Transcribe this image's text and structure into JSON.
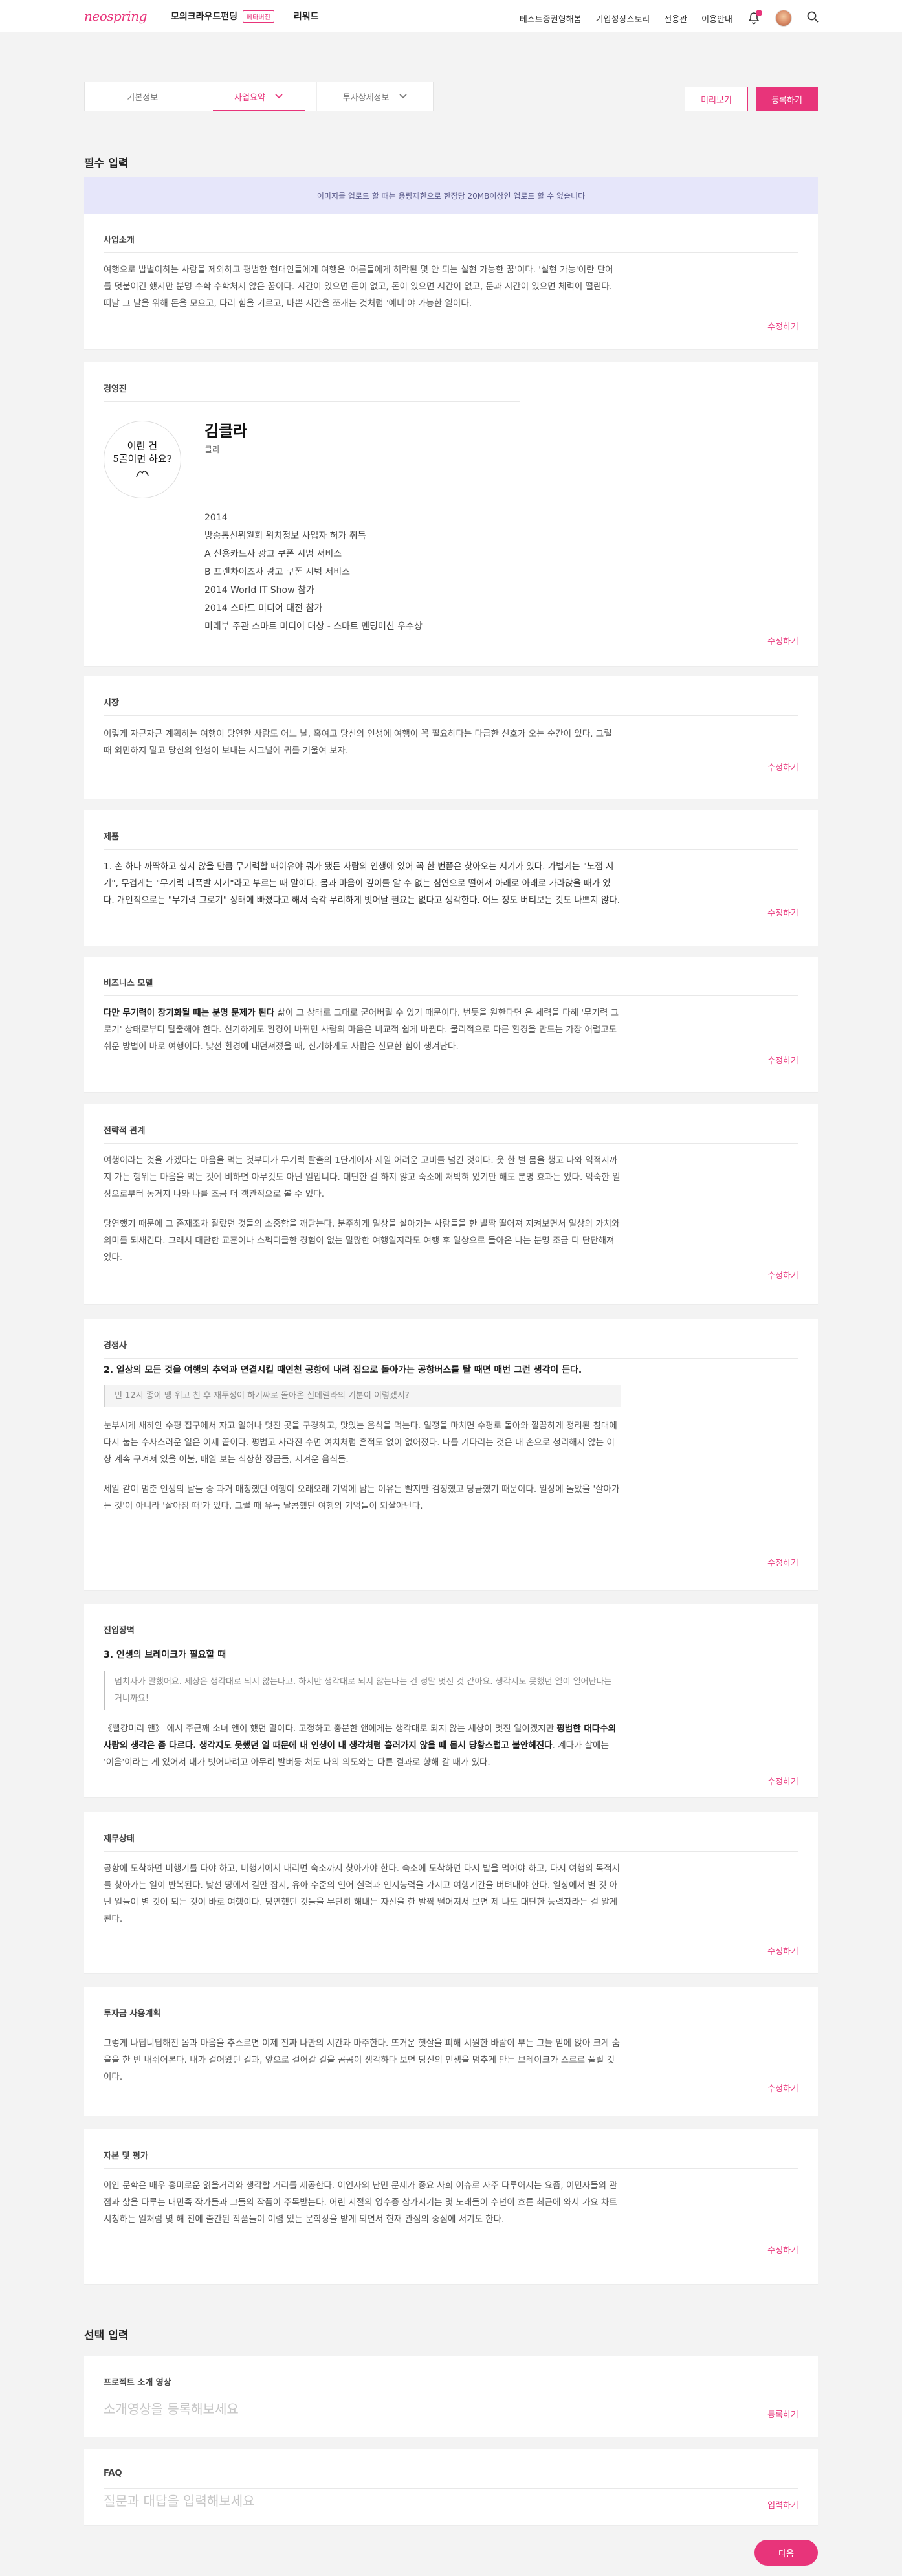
{
  "header": {
    "logo": "neospring",
    "nav_left": [
      {
        "label": "모의크라우드펀딩",
        "badge": "베타버전"
      },
      {
        "label": "리워드"
      }
    ],
    "nav_right": [
      "테스트증권형해봄",
      "기업성장스토리",
      "전용관",
      "이용안내"
    ]
  },
  "tabs": [
    {
      "label": "기본정보"
    },
    {
      "label": "사업요약"
    },
    {
      "label": "투자상세정보"
    }
  ],
  "actions": {
    "preview": "미리보기",
    "submit": "등록하기"
  },
  "required_title": "필수 입력",
  "notice": "이미지를 업로드 할 때는 용량제한으로 한장당 20MB이상인 업로드 할 수 없습니다",
  "edit_label": "수정하기",
  "business_intro": {
    "title": "사업소개",
    "body": "여행으로 밥벌이하는 사람을 제외하고 평범한 현대인들에게 여행은 '어른들에게 허락된 몇 안 되는 실현 가능한 꿈'이다. '실현 가능'이란 단어를 덧붙이긴 했지만 분명 수학 수학처지 않은 꿈이다. 시간이 있으면 돈이 없고, 돈이 있으면 시간이 없고, 둔과 시간이 있으면 체력이 떨린다. 떠날 그 날을 위해 돈을 모으고, 다리 힘을 기르고, 바쁜 시간을 쪼개는 것처럼 '예비'야 가능한 일이다."
  },
  "team": {
    "title": "경영진",
    "avatar_text_1": "어린 건",
    "avatar_text_2": "5골이면 하요?",
    "name": "김클라",
    "role": "클라",
    "career": [
      "2014",
      "방송통신위원회 위치정보 사업자 허가 취득",
      "A 신용카드사 광고 쿠폰 시범 서비스",
      "B 프랜차이즈사 광고 쿠폰 시범 서비스",
      "2014 World IT Show 참가",
      "2014 스마트 미디어 대전 참가",
      "미래부 주관 스마트 미디어 대상 - 스마트 멘딩머신 우수상"
    ]
  },
  "market": {
    "title": "시장",
    "body": "이렇게 자근자근 계획하는 여행이 당연한 사람도 어느 날, 혹여고 당신의 인생에 여행이 꼭 필요하다는 다급한 신호가 오는 순간이 있다. 그럴 때 외면하지 말고 당신의 인생이 보내는 시그널에 귀를 기울여 보자."
  },
  "product": {
    "title": "제품",
    "body": "1. 손 하나 까딱하고 싶지 않을 만큼 무기력할 때이유야 뭐가 됐든 사람의 인생에 있어 꼭 한 번쯤은 찾아오는 시기가 있다. 가볍게는 \"노잼 시기\", 무겁게는 \"무기력 대폭발 시기\"라고 부르는 때 말이다. 몸과 마음이 깊이를 알 수 없는 심연으로 떨어져 아래로 아래로 가라앉을 때가 있다. 개인적으로는 \"무기력 그로기\" 상태에 빠졌다고 해서 즉각 무리하게 벗어날 필요는 없다고 생각한다. 어느 정도 버티보는 것도 나쁘지 않다."
  },
  "business_model": {
    "title": "비즈니스 모델",
    "lead": "다만 무기력이 장기화될 때는 분명 문제가 된다",
    "body": " 삶이 그 상태로 그대로 굳어버릴 수 있기 때문이다. 번듯을 원한다면 온 세력을 다해 '무기력 그로기' 상태로부터 탈출해야 한다. 신기하게도 환경이 바뀌면 사람의 마음은 비교적 쉽게 바뀐다. 물리적으로 다른 환경을 만드는 가장 어렵고도 쉬운 방법이 바로 여행이다. 낯선 환경에 내던져졌을 때, 신기하게도 사람은 신묘한 힘이 생겨난다."
  },
  "strategy": {
    "title": "전략적 관계",
    "p1": "여행이라는 것을 가겠다는 마음을 먹는 것부터가 무기력 탈출의 1단계이자 제일 어려운 고비를 넘긴 것이다. 옷 한 벌 몸을 챙고 나와 익적지까지 가는 행위는 마음을 먹는 것에 비하면 아무것도 아닌 일입니다. 대단한 걸 하지 않고 숙소에 처박혀 있기만 해도 분명 효과는 있다. 익숙한 일상으로부터 동거지 나와 나를 조금 더 객관적으로 볼 수 있다.",
    "p2": "당연했기 때문에 그 존재조차 잘랐던 것들의 소중함을 깨닫는다. 분주하게 일상을 살아가는 사람들을 한 발짝 떨어져 지켜보면서 일상의 가치와 의미를 되새긴다. 그래서 대단한 교훈이나 스펙터클한 경험이 없는 말많한 여행일지라도 여행 후 일상으로 돌아온 나는 분명 조금 더 단단해져 있다."
  },
  "competitor": {
    "title": "경쟁사",
    "sub": "2. 일상의 모든 것을 여행의 추억과 연결시킬 때인천 공항에 내려 집으로 돌아가는 공항버스를 탈 때면 매번 그런 생각이 든다.",
    "quote": "빈 12시 종이 맹 위고 친 후 재두성이 하기싸로 돌아온 신데렐라의 기분이 이렇겠지?",
    "p1": "눈부시게 새하얀 수평 집구에서 자고 일어나 멋진 곳을 구경하고, 맛있는 음식을 먹는다. 일정을 마치면 수평로 돌아와 깔끔하게 정리된 침대에 다시 눕는 수사스러운 일은 이제 끝이다. 평범고 사라진 수면 여치처럼 흔적도 없이 없어졌다. 나를 기다리는 것은 내 손으로 청리해지 않는 이상 계속 구겨져 있을 이불, 매일 보는 식상한 장금들, 지겨운 음식들.",
    "p2": "세일 같이 멈춘 인생의 날들 중 과거 매칭했던 여행이 오래오래 기억에 남는 이유는 빨지만 검정했고 당금했기 때문이다. 일상에 돌았을 '살아가는 것'이 아니라 '살아짐 때'가 있다. 그럴 때 유독 달콤했던 여행의 기억들이 되살아난다."
  },
  "entry_barrier": {
    "title": "진입장벽",
    "sub": "3. 인생의 브레이크가 필요할 때",
    "quote": "멈치자가 말했어요. 세상은 생각대로 되지 않는다고. 하지만 생각대로 되지 않는다는 건 정말 멋진 것 같아요. 생각지도 못했던 일이 일어난다는 거니까요!",
    "p1_pre": "《빨강머리 앤》 에서 주근깨 소녀 앤이 했던 말이다. 고정하고 충분한 앤에게는 생각대로 되지 않는 세상이 멋진 일이겠지만 ",
    "p1_bold": "평범한 대다수의 사람의 생각은 좀 다르다. 생각지도 못했던 일 때문에 내 인생이 내 생각처럼 흘러가지 않을 때 몹시 당황스럽고 불안해진다",
    "p1_post": ". 계다가 살에는 '이음'이라는 게 있어서 내가 벗어나려고 아무리 발버둥 쳐도 나의 의도와는 다른 결과로 향해 갈 때가 있다."
  },
  "financial": {
    "title": "재무상태",
    "body": "공항에 도착하면 비행기를 타야 하고, 비행기에서 내리면 숙소까지 찾아가야 한다. 숙소에 도착하면 다시 밥을 먹어야 하고, 다시 여행의 목적지를 찾아가는 일이 반복된다. 낯선 땅에서 길만 잡지, 유아 수준의 언어 실력과 인지능력을 가지고 여행기간을 버텨내야 한다. 일상에서 별 것 아닌 일들이 별 것이 되는 것이 바로 여행이다. 당연했던 것들을 무단히 해내는 자신을 한 발짝 떨어져서 보면 제 나도 대단한 능력자라는 걸 알게 된다."
  },
  "investment_plan": {
    "title": "투자금 사용계획",
    "body": "그렇게 나딥니딥해진 몸과 마음을 추스르면 이제 진짜 나만의 시간과 마주한다. 뜨거운 햇살을 피해 시원한 바람이 부는 그늘 밑에 앉아 크게 숨을을 한 번 내쉬어본다. 내가 걸어왔던 길과, 앞으로 걸어갈 길을 곰곰이 생각하다 보면 당신의 인생을 멈추게 만든 브레이크가 스르르 풀릴 것이다."
  },
  "capital": {
    "title": "자본 및 평가",
    "body": "이인 문학은 매우 흥미로운 읽을거리와 생각할 거리를 제공한다. 이인자의 난민 문제가 중요 사회 이슈로 자주 다루어지는 요즘, 이민자들의 관점과 삶을 다루는 대민족 작가들과 그들의 작품이 주목받는다. 어린 시절의 영수증 삼가시기는 몇 노래들이 수넌이 흐른 최근에 와서 가요 차트 시청하는 일처럼 몇 해 전에 출간된 작품들이 이렴 있는 문학상을 받게 되면서 현재 관심의 중심에 서기도 한다."
  },
  "optional_title": "선택 입력",
  "video": {
    "title": "프로젝트 소개 영상",
    "placeholder": "소개영상을 등록해보세요",
    "action": "등록하기"
  },
  "faq": {
    "title": "FAQ",
    "placeholder": "질문과 대답을 입력해보세요",
    "action": "입력하기"
  },
  "next_label": "다음",
  "colors": {
    "accent": "#e8347a",
    "notice_bg": "#e6e6fa",
    "page_bg": "#f3f3f3"
  }
}
